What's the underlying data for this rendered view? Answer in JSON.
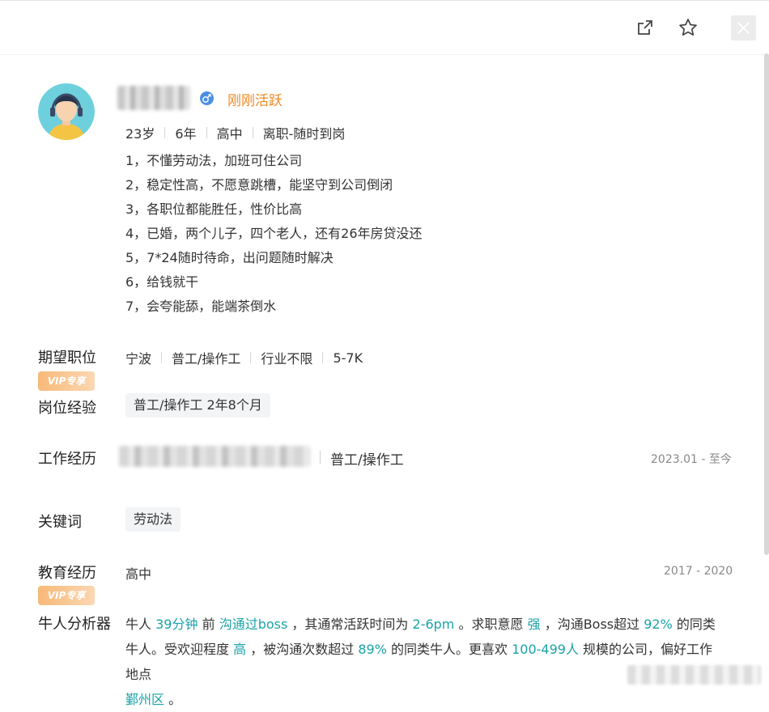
{
  "toolbar": {
    "share_icon": "share-icon",
    "star_icon": "star-icon",
    "close_icon": "close-icon"
  },
  "profile": {
    "status": "刚刚活跃",
    "meta": [
      "23岁",
      "6年",
      "高中",
      "离职-随时到岗"
    ],
    "highlights": [
      "1，不懂劳动法，加班可住公司",
      "2，稳定性高，不愿意跳槽，能坚守到公司倒闭",
      "3，各职位都能胜任，性价比高",
      "4，已婚，两个儿子，四个老人，还有26年房贷没还",
      "5，7*24随时待命，出问题随时解决",
      "6，给钱就干",
      "7，会夸能舔，能端茶倒水"
    ]
  },
  "vip_badge": "VIP专享",
  "expectation": {
    "label": "期望职位",
    "values": [
      "宁波",
      "普工/操作工",
      "行业不限",
      "5-7K"
    ]
  },
  "experience": {
    "label": "岗位经验",
    "chip": "普工/操作工 2年8个月"
  },
  "work": {
    "label": "工作经历",
    "title": "普工/操作工",
    "period": "2023.01 - 至今"
  },
  "keywords": {
    "label": "关键词",
    "chips": [
      "劳动法"
    ]
  },
  "education": {
    "label": "教育经历",
    "level": "高中",
    "period": "2017 - 2020"
  },
  "analyzer": {
    "label": "牛人分析器",
    "t1": "牛人",
    "v1": "39分钟",
    "t2": "前",
    "v2": "沟通过boss",
    "t3": "，其通常活跃时间为",
    "v3": "2-6pm",
    "t4": "。求职意愿",
    "v4": "强",
    "t5": "，沟通Boss超过",
    "v5": "92%",
    "t6": "的同类牛人。受欢迎程度",
    "v6": "高",
    "t7": "，被沟通次数超过",
    "v7": "89%",
    "t8": "的同类牛人。更喜欢",
    "v8": "100-499人",
    "t9": "规模的公司，偏好工作地点",
    "v9": "鄞州区",
    "t10": "。"
  }
}
